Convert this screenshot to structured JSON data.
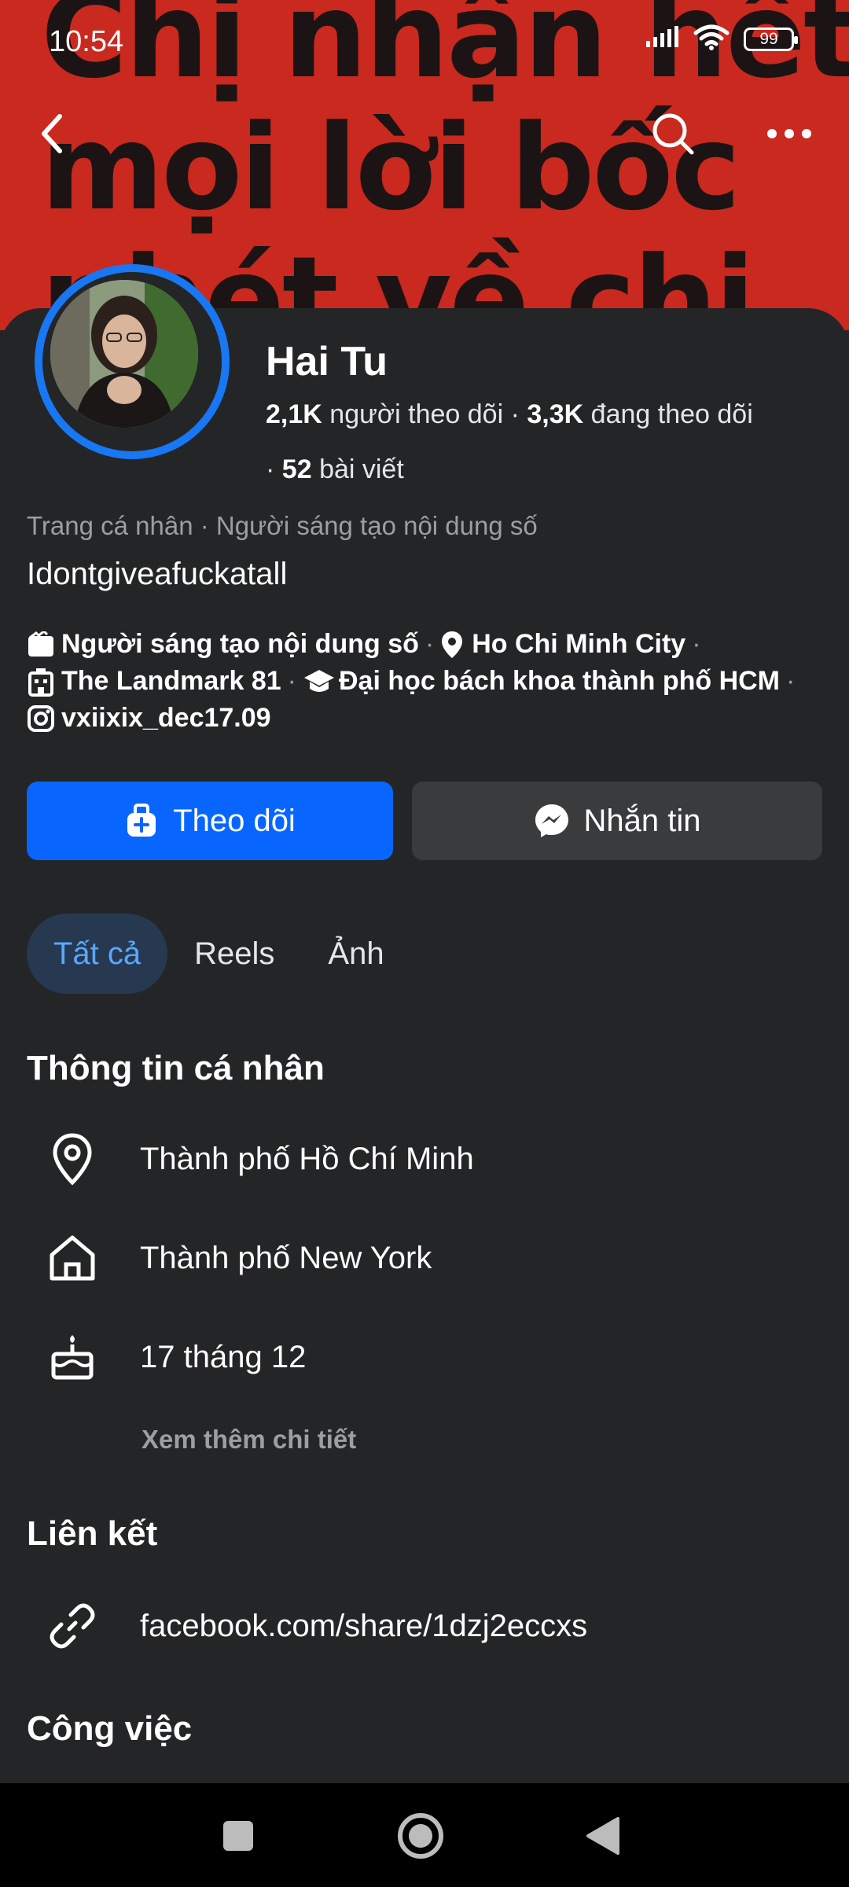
{
  "status_bar": {
    "time": "10:54",
    "battery": "99"
  },
  "cover": {
    "text_lines": [
      "Chị nhận hết",
      "mọi lời bốc",
      "phét về chị"
    ]
  },
  "profile": {
    "name": "Hai Tu",
    "followers_count": "2,1K",
    "followers_label": "người theo dõi",
    "following_count": "3,3K",
    "following_label": "đang theo dõi",
    "posts_count": "52",
    "posts_label": "bài viết",
    "subtitle": "Trang cá nhân · Người sáng tạo nội dung số",
    "bio": "Idontgiveafuckatall"
  },
  "details": {
    "category": "Người sáng tạo nội dung số",
    "city": "Ho Chi Minh City",
    "workplace": "The Landmark 81",
    "school": "Đại học bách khoa thành phố HCM",
    "instagram": "vxiixix_dec17.09"
  },
  "actions": {
    "follow_label": "Theo dõi",
    "message_label": "Nhắn tin"
  },
  "tabs": [
    {
      "label": "Tất cả",
      "active": true
    },
    {
      "label": "Reels",
      "active": false
    },
    {
      "label": "Ảnh",
      "active": false
    }
  ],
  "personal_info": {
    "title": "Thông tin cá nhân",
    "items": [
      {
        "icon": "location-pin-icon",
        "text": "Thành phố Hồ Chí Minh"
      },
      {
        "icon": "home-icon",
        "text": "Thành phố New York"
      },
      {
        "icon": "birthday-cake-icon",
        "text": "17 tháng 12"
      }
    ],
    "more_label": "Xem thêm chi tiết"
  },
  "links": {
    "title": "Liên kết",
    "url": "facebook.com/share/1dzj2eccxs"
  },
  "work": {
    "title": "Công việc"
  },
  "colors": {
    "accent": "#0866ff",
    "ring": "#1877f2",
    "cover": "#c9291e",
    "background": "#242526",
    "tab_active_bg": "#263951",
    "tab_active_text": "#5aa7ff"
  }
}
